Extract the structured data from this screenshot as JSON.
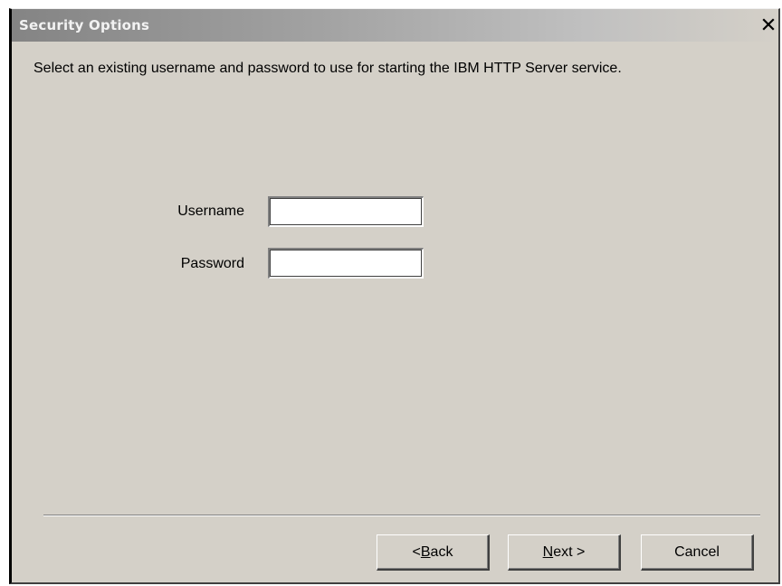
{
  "window": {
    "title": "Security Options"
  },
  "description": "Select an existing username and password to use for starting the IBM HTTP Server service.",
  "form": {
    "username_label": "Username",
    "username_value": "",
    "password_label": "Password",
    "password_value": ""
  },
  "buttons": {
    "back": {
      "prefix": "< ",
      "accel": "B",
      "rest": "ack"
    },
    "next": {
      "prefix": "",
      "accel": "N",
      "rest": "ext >"
    },
    "cancel": "Cancel"
  },
  "colors": {
    "dialog_background": "#d4d0c8",
    "titlebar_start": "#848484",
    "titlebar_end": "#d4d0c8"
  },
  "icons": {
    "close": "close-icon"
  }
}
